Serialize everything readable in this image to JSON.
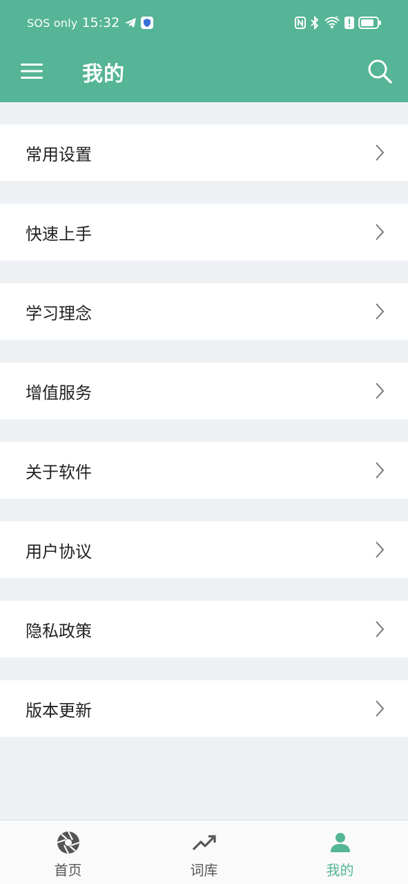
{
  "status_bar": {
    "carrier": "SOS only",
    "time": "15:32",
    "icons": [
      "telegram-icon",
      "shield-icon",
      "nfc-icon",
      "bluetooth-icon",
      "wifi-icon",
      "alert-icon",
      "battery-icon"
    ]
  },
  "app_bar": {
    "title": "我的",
    "menu_icon": "hamburger-icon",
    "search_icon": "search-icon"
  },
  "menu_items": [
    {
      "label": "常用设置"
    },
    {
      "label": "快速上手"
    },
    {
      "label": "学习理念"
    },
    {
      "label": "增值服务"
    },
    {
      "label": "关于软件"
    },
    {
      "label": "用户协议"
    },
    {
      "label": "隐私政策"
    },
    {
      "label": "版本更新"
    }
  ],
  "bottom_nav": {
    "tabs": [
      {
        "label": "首页",
        "icon": "aperture-icon",
        "active": false
      },
      {
        "label": "词库",
        "icon": "trending-up-icon",
        "active": false
      },
      {
        "label": "我的",
        "icon": "person-icon",
        "active": true
      }
    ]
  },
  "colors": {
    "accent": "#55b596",
    "background": "#edf1f4",
    "row": "#ffffff",
    "text": "#222222"
  }
}
